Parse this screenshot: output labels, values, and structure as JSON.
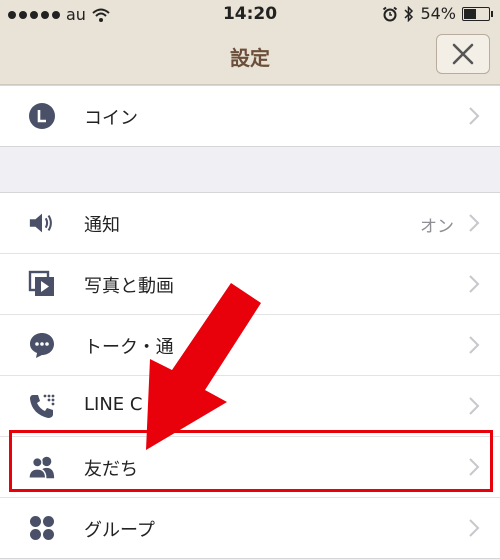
{
  "status_bar": {
    "carrier": "au",
    "time": "14:20",
    "battery": "54%",
    "battery_level": 0.54
  },
  "header": {
    "title": "設定",
    "close_icon": "close-x-icon"
  },
  "groups": [
    {
      "items": [
        {
          "label": "コイン",
          "icon": "coin-icon"
        }
      ]
    },
    {
      "items": [
        {
          "label": "通知",
          "value": "オン",
          "icon": "speaker-icon"
        },
        {
          "label": "写真と動画",
          "icon": "photo-video-icon"
        },
        {
          "label": "トーク・通",
          "icon": "chat-bubble-icon"
        },
        {
          "label": "LINE C",
          "icon": "phone-call-icon"
        },
        {
          "label": "友だち",
          "icon": "friends-icon"
        },
        {
          "label": "グループ",
          "icon": "group-icon"
        }
      ]
    }
  ],
  "colors": {
    "header_bg": "#e9e2d6",
    "header_title": "#6b4f3a",
    "icon": "#4a5068",
    "highlight": "#e8000b"
  }
}
